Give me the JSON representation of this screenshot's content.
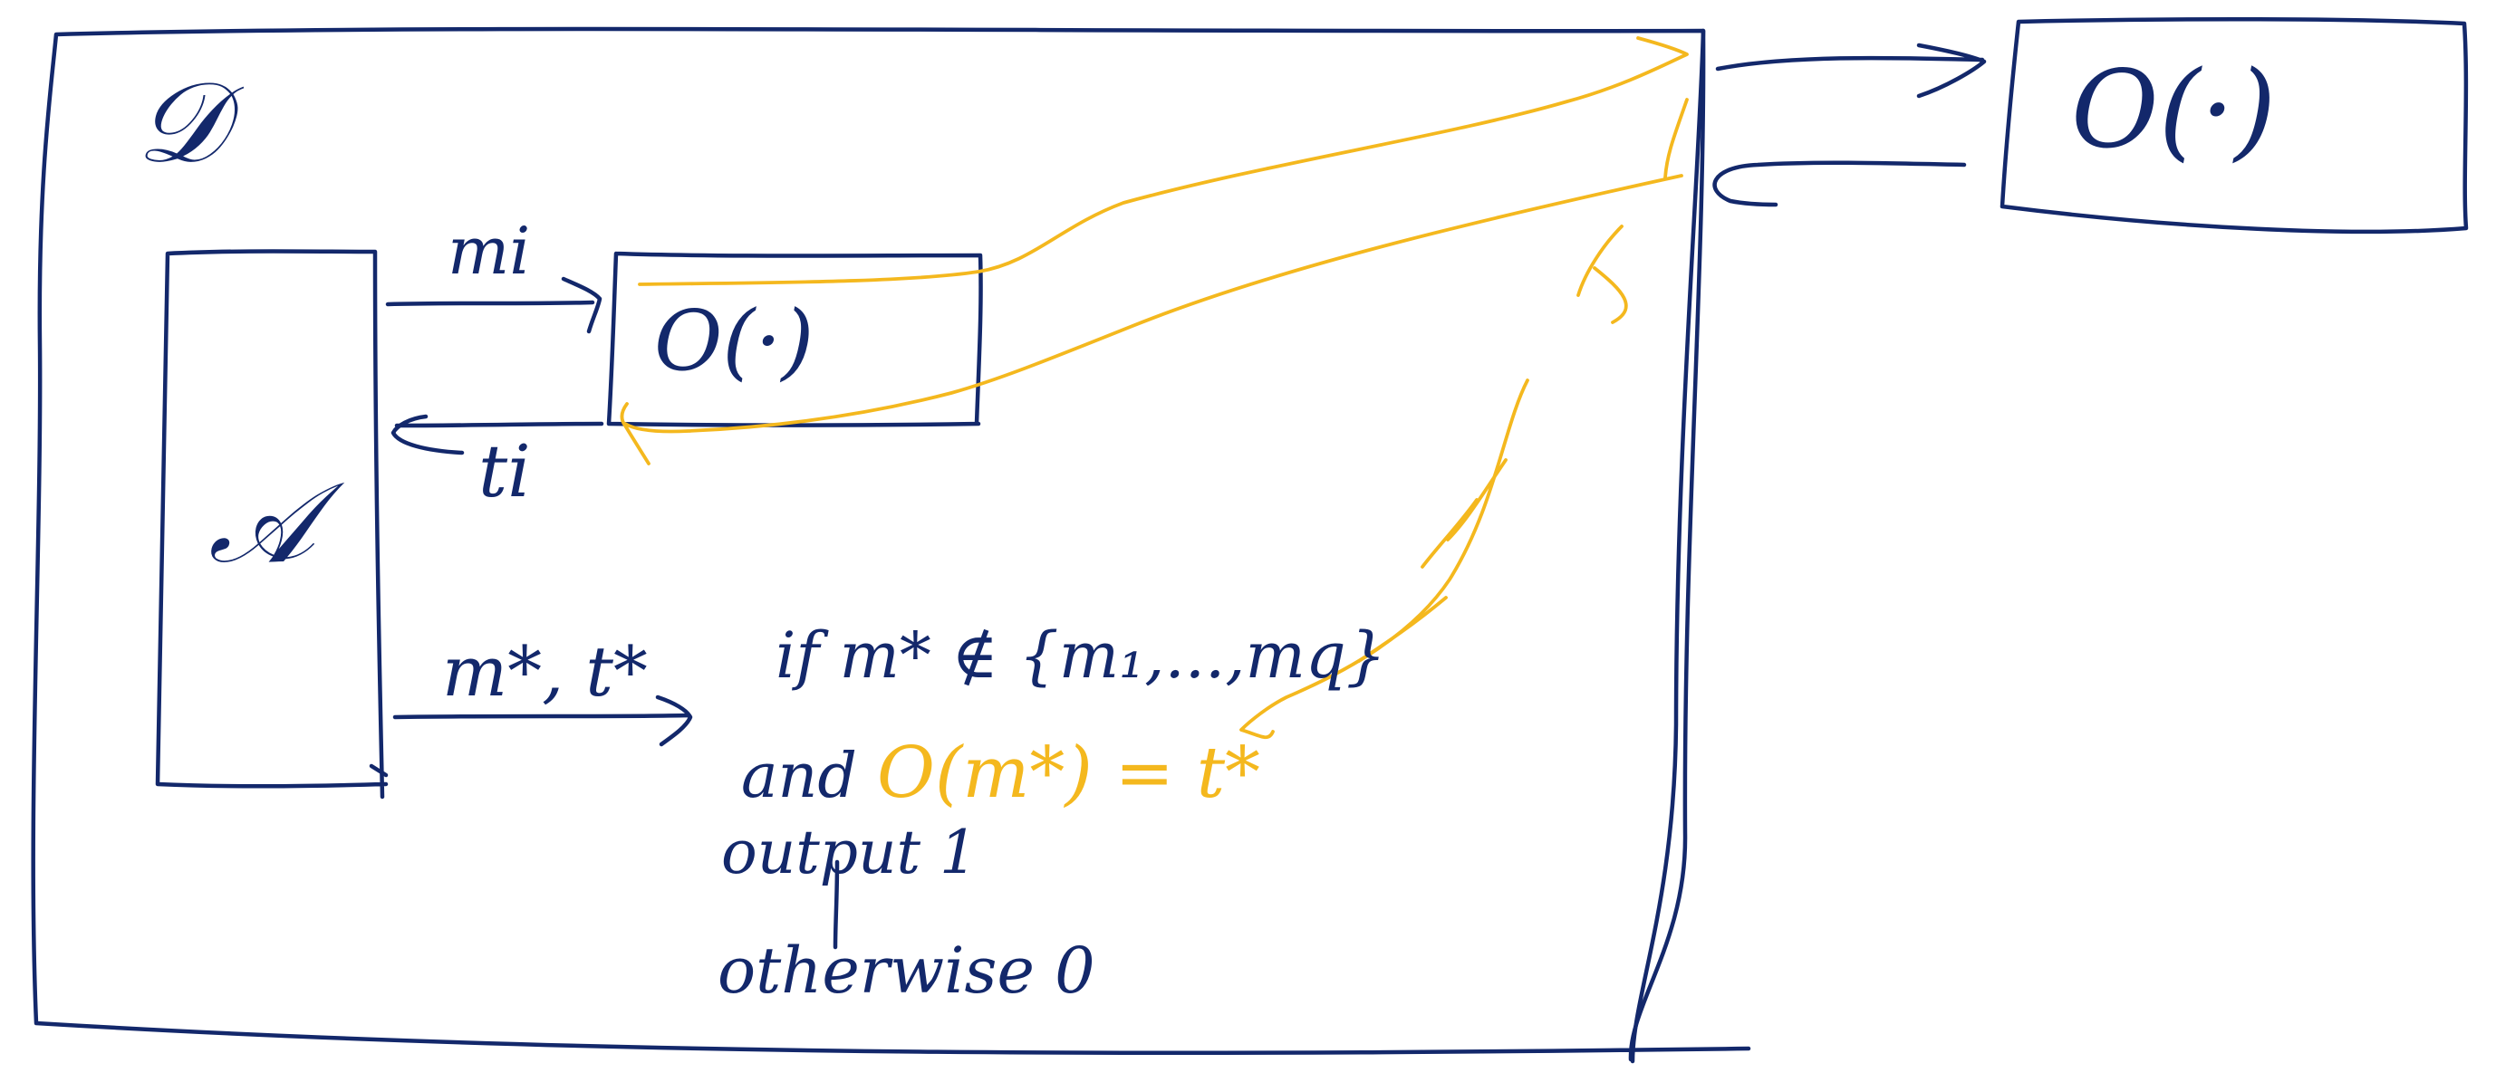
{
  "colors": {
    "ink_primary": "#13286b",
    "ink_accent": "#f4b81e",
    "background": "#ffffff"
  },
  "labels": {
    "reduction": "𝒟",
    "adversary": "𝒜",
    "inner_oracle": "O(·)",
    "outer_oracle": "O(·)",
    "query": "mi",
    "tag": "ti",
    "forgery": "m*, t*"
  },
  "condition": {
    "if_text": "if m* ∉ {m₁,...,mq}",
    "and_prefix": "and",
    "and_expr": "O(m*) = t*",
    "output_text": "output 1",
    "otherwise_text": "otherwise 0"
  }
}
